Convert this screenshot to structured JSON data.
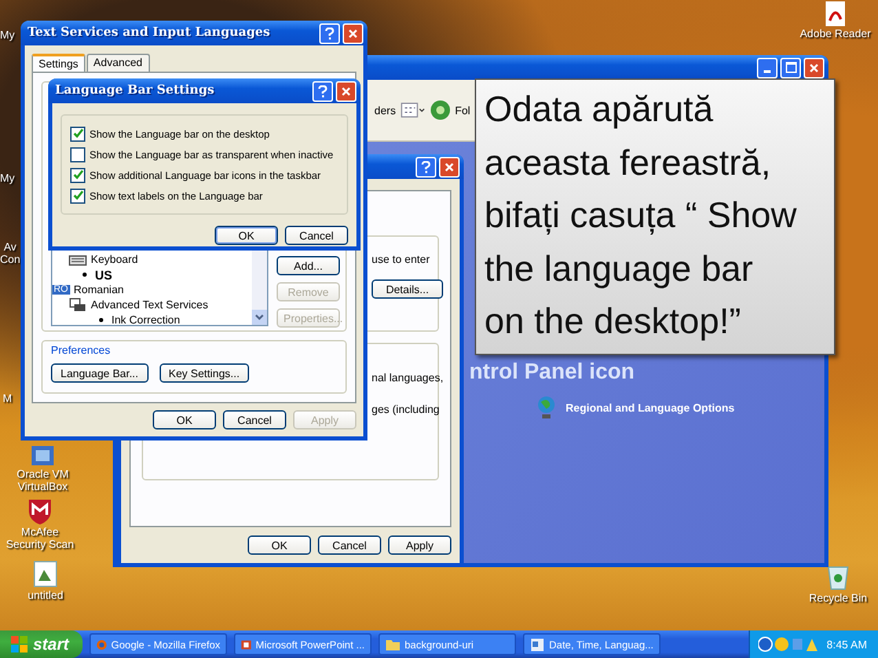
{
  "desktop_icons": [
    {
      "label": "My",
      "kind": "partial"
    },
    {
      "label": "My",
      "kind": "partial"
    },
    {
      "label": "Av\nCon",
      "kind": "partial"
    },
    {
      "label": "M",
      "kind": "partial"
    },
    {
      "label": "Oracle VM\nVirtualBox",
      "kind": "box"
    },
    {
      "label": "McAfee\nSecurity Scan",
      "kind": "shield"
    },
    {
      "label": "untitled",
      "kind": "picture"
    },
    {
      "label": "Adobe Reader",
      "kind": "pdf"
    },
    {
      "label": "Recycle Bin",
      "kind": "bin"
    }
  ],
  "control_panel": {
    "toolbar": [
      "ders",
      "Fol"
    ],
    "heading": "ntrol Panel icon",
    "link": "Regional and Language Options"
  },
  "regional_dialog": {
    "texts": [
      "use to enter",
      "nal languages,",
      "ges (including"
    ],
    "details_button": "Details...",
    "buttons": [
      {
        "label": "OK",
        "disabled": false
      },
      {
        "label": "Cancel",
        "disabled": false
      },
      {
        "label": "Apply",
        "disabled": false
      }
    ]
  },
  "text_services": {
    "title": "Text Services and Input Languages",
    "tabs": [
      {
        "label": "Settings",
        "selected": true
      },
      {
        "label": "Advanced",
        "selected": false
      }
    ],
    "services": [
      {
        "label": "Keyboard",
        "kind": "keyboard",
        "children": [
          {
            "label": "US",
            "kind": "bullet"
          }
        ]
      },
      {
        "label": "Romanian",
        "kind": "language",
        "badge": "RO",
        "children": [
          {
            "label": "Advanced Text Services",
            "kind": "services",
            "children": [
              {
                "label": "Ink Correction",
                "kind": "bullet"
              }
            ]
          }
        ]
      }
    ],
    "side_buttons": [
      {
        "label": "Add...",
        "disabled": false
      },
      {
        "label": "Remove",
        "disabled": true
      },
      {
        "label": "Properties...",
        "disabled": true
      }
    ],
    "preferences": {
      "title": "Preferences",
      "buttons": [
        "Language Bar...",
        "Key Settings..."
      ]
    },
    "buttons": [
      {
        "label": "OK",
        "disabled": false
      },
      {
        "label": "Cancel",
        "disabled": false
      },
      {
        "label": "Apply",
        "disabled": true
      }
    ]
  },
  "language_bar_settings": {
    "title": "Language Bar Settings",
    "options": [
      {
        "label": "Show the Language bar on the desktop",
        "checked": true
      },
      {
        "label": "Show the Language bar as transparent when inactive",
        "checked": false
      },
      {
        "label": "Show additional Language bar icons in the taskbar",
        "checked": true
      },
      {
        "label": "Show text labels on the Language bar",
        "checked": true
      }
    ],
    "buttons": [
      "OK",
      "Cancel"
    ]
  },
  "callout": {
    "text": "Odata apărută\naceasta fereastră,\nbifați casuța “ Show\nthe language bar\non the desktop!”"
  },
  "taskbar": {
    "start": "start",
    "tasks": [
      {
        "label": "Google - Mozilla Firefox",
        "kind": "firefox"
      },
      {
        "label": "Microsoft PowerPoint ...",
        "kind": "powerpoint"
      },
      {
        "label": "background-uri",
        "kind": "folder"
      },
      {
        "label": "Date, Time, Languag...",
        "kind": "control"
      }
    ],
    "clock": "8:45 AM"
  }
}
